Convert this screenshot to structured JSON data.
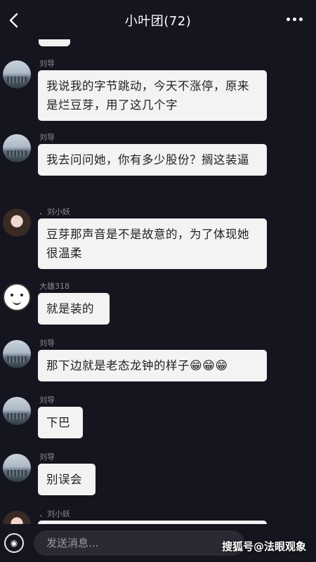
{
  "header": {
    "back_icon": "chevron-left-icon",
    "title": "小叶团(72)",
    "more_icon": "more-dots-icon"
  },
  "messages": [
    {
      "sender": "刘导",
      "avatar": "city-avatar",
      "text": "我说我的字节跳动，今天不涨停，原来是烂豆芽，用了这几个字"
    },
    {
      "sender": "刘导",
      "avatar": "city-avatar",
      "text": "我去问问她，你有多少股份？搁这装逼"
    },
    {
      "sender": "、刘小妖",
      "avatar": "girl-avatar",
      "text": "豆芽那声音是不是故意的，为了体现她很温柔"
    },
    {
      "sender": "大雄318",
      "avatar": "cartoon-avatar",
      "text": "就是装的"
    },
    {
      "sender": "刘导",
      "avatar": "city-avatar",
      "text": "那下边就是老态龙钟的样子",
      "emoji": "😁😁😁"
    },
    {
      "sender": "刘导",
      "avatar": "city-avatar",
      "text": "下巴"
    },
    {
      "sender": "刘导",
      "avatar": "city-avatar",
      "text": "别误会"
    },
    {
      "sender": "、刘小妖",
      "avatar": "girl-avatar",
      "text": ""
    }
  ],
  "composer": {
    "voice_icon": "voice-icon",
    "placeholder": "发送消息..."
  },
  "watermark": "搜狐号@法眼观象"
}
